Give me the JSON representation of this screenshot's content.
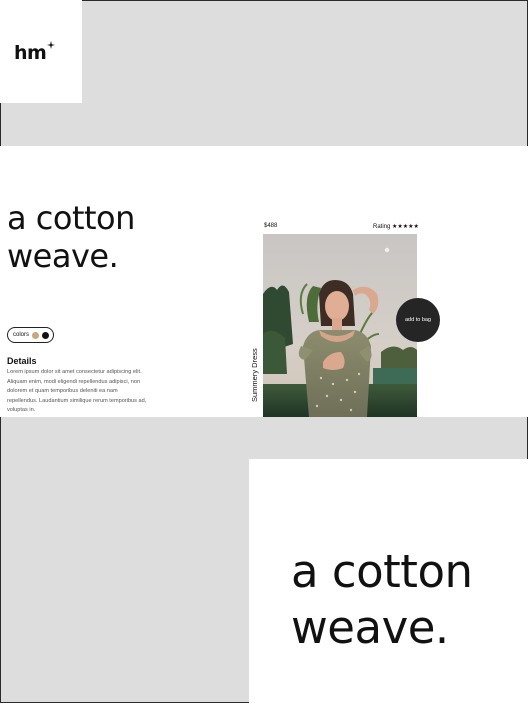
{
  "brand": {
    "logo_text": "hm"
  },
  "hero": {
    "title_line1": "a cotton",
    "title_line2": "weave."
  },
  "product": {
    "price": "$488",
    "rating_label": "Rating",
    "rating_stars": "★★★★★",
    "name": "Summery Dress",
    "add_to_bag_label": "add to bag",
    "colors_label": "colors",
    "swatches": [
      {
        "name": "tan-swatch",
        "color": "#c9a77a"
      },
      {
        "name": "black-swatch",
        "color": "#111111"
      }
    ]
  },
  "details": {
    "heading": "Details",
    "body": "Lorem ipsum dolor sit amet consectetur adipiscing elit. Aliquam enim, modi eligendi repellendus adipisci, non dolorem et quam temporibus deleniti ea nam repellendus. Laudantium similique rerum temporibus ad, voluptas in."
  },
  "bottom_feature": {
    "title_line1": "a cotton",
    "title_line2": "weave."
  }
}
